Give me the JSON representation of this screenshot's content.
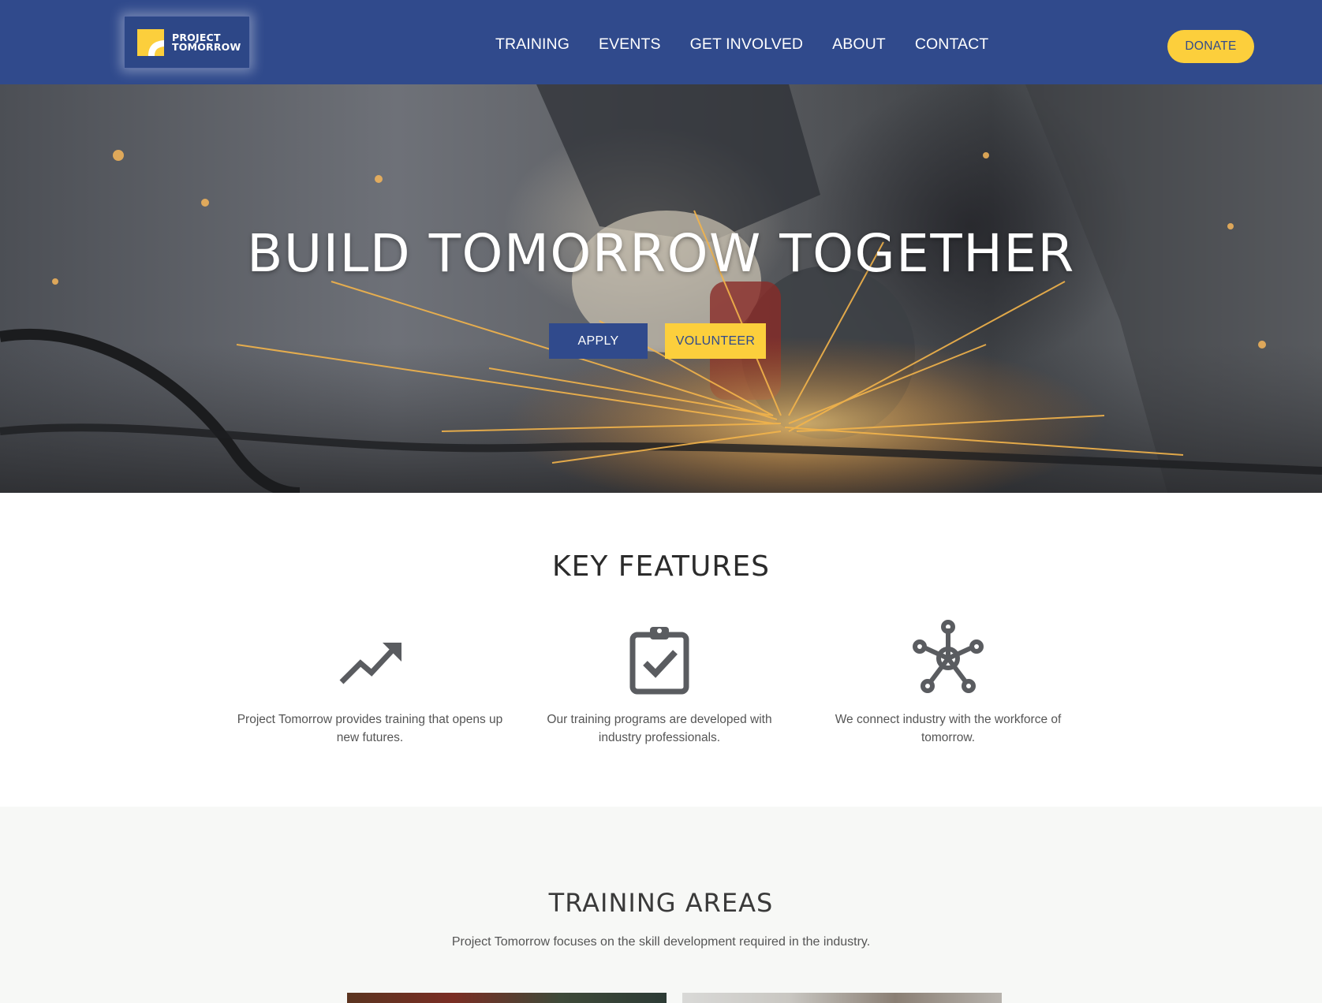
{
  "brand": {
    "line1": "PROJECT",
    "line2": "TOMORROW",
    "colors": {
      "primary": "#304a8c",
      "accent": "#fccf3c"
    }
  },
  "nav": {
    "items": [
      {
        "label": "TRAINING"
      },
      {
        "label": "EVENTS"
      },
      {
        "label": "GET INVOLVED"
      },
      {
        "label": "ABOUT"
      },
      {
        "label": "CONTACT"
      }
    ],
    "donate_label": "DONATE"
  },
  "hero": {
    "title": "BUILD TOMORROW TOGETHER",
    "apply_label": "APPLY",
    "volunteer_label": "VOLUNTEER"
  },
  "features": {
    "title": "KEY FEATURES",
    "items": [
      {
        "icon": "trending-up-icon",
        "text": "Project Tomorrow provides training that opens up new futures."
      },
      {
        "icon": "clipboard-check-icon",
        "text": "Our training programs are developed with industry professionals."
      },
      {
        "icon": "network-hub-icon",
        "text": "We connect industry with the workforce of tomorrow."
      }
    ]
  },
  "training": {
    "title": "TRAINING AREAS",
    "subtitle": "Project Tomorrow focuses on the skill development required in the industry."
  }
}
